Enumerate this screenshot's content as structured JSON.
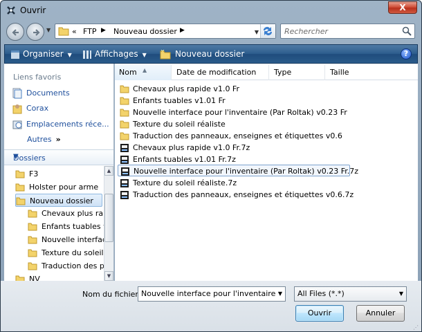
{
  "window": {
    "title": "Ouvrir",
    "close_label": "X"
  },
  "address": {
    "back_icon": "back-arrow-icon",
    "forward_icon": "forward-arrow-icon",
    "prefix": "«",
    "crumbs": [
      "FTP",
      "Nouveau dossier"
    ]
  },
  "search": {
    "placeholder": "Rechercher"
  },
  "toolbar": {
    "organiser": "Organiser",
    "affichages": "Affichages",
    "nouveau_dossier": "Nouveau dossier",
    "help": "?",
    "accent": "#2e5e8e"
  },
  "favorites": {
    "heading": "Liens favoris",
    "items": [
      {
        "label": "Documents",
        "icon": "documents-icon"
      },
      {
        "label": "Corax",
        "icon": "user-folder-icon"
      },
      {
        "label": "Emplacements réce...",
        "icon": "recent-places-icon"
      }
    ],
    "more": "Autres",
    "more_arrow": "»"
  },
  "folders": {
    "heading": "Dossiers",
    "tree": [
      {
        "label": "F3",
        "level": 1
      },
      {
        "label": "Holster pour arme",
        "level": 1
      },
      {
        "label": "Nouveau dossier",
        "level": 1,
        "selected": true
      },
      {
        "label": "Chevaux plus rap",
        "level": 2
      },
      {
        "label": "Enfants tuables v",
        "level": 2
      },
      {
        "label": "Nouvelle interfac",
        "level": 2
      },
      {
        "label": "Texture du soleil",
        "level": 2
      },
      {
        "label": "Traduction des p",
        "level": 2
      },
      {
        "label": "NV",
        "level": 1
      }
    ]
  },
  "columns": [
    "Nom",
    "Date de modification",
    "Type",
    "Taille"
  ],
  "files": [
    {
      "name": "Chevaux plus rapide v1.0 Fr",
      "kind": "folder"
    },
    {
      "name": "Enfants tuables v1.01 Fr",
      "kind": "folder"
    },
    {
      "name": "Nouvelle interface pour l'inventaire (Par Roltak) v0.23 Fr",
      "kind": "folder"
    },
    {
      "name": "Texture du soleil réaliste",
      "kind": "folder"
    },
    {
      "name": "Traduction des panneaux, enseignes et étiquettes v0.6",
      "kind": "folder"
    },
    {
      "name": "Chevaux plus rapide v1.0 Fr.7z",
      "kind": "archive"
    },
    {
      "name": "Enfants tuables v1.01 Fr.7z",
      "kind": "archive"
    },
    {
      "name": "Nouvelle interface pour l'inventaire (Par Roltak) v0.23 Fr.7z",
      "kind": "archive",
      "selected": true
    },
    {
      "name": "Texture du soleil réaliste.7z",
      "kind": "archive"
    },
    {
      "name": "Traduction des panneaux, enseignes et étiquettes v0.6.7z",
      "kind": "archive"
    }
  ],
  "footer": {
    "filename_label": "Nom du fichier :",
    "filename_value": "Nouvelle interface pour l'inventaire (Par R",
    "filter_value": "All Files (*.*)",
    "ok": "Ouvrir",
    "cancel": "Annuler"
  }
}
